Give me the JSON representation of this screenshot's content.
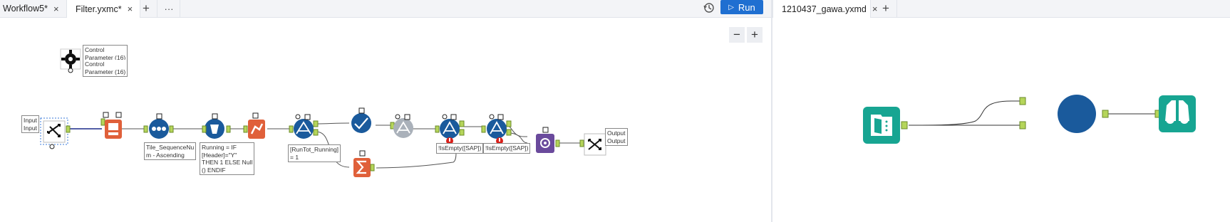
{
  "left_tabs": [
    {
      "label": "Workflow5*",
      "close": "×"
    },
    {
      "label": "Filter.yxmc*",
      "close": "×"
    }
  ],
  "left_toolbar": {
    "add": "+",
    "more": "···",
    "run_label": "Run",
    "run_icon": "play-icon",
    "history_icon": "history-icon"
  },
  "right_tabs": [
    {
      "label": "1210437_gawa.yxmd",
      "close": "×"
    }
  ],
  "right_toolbar": {
    "add": "+"
  },
  "zoom": {
    "out": "−",
    "in": "+"
  },
  "annotations": {
    "control_param_1": "Control\nParameter (16)",
    "control_param_2": "Control\nParameter (16)",
    "input": "Input\nInput",
    "sort": "Tile_SequenceNu\nm - Ascending",
    "formula": "Running = IF\n[Header]=\"Y\"\nTHEN 1 ELSE Null\n() ENDIF",
    "filter1": "[RunTot_Running]\n= 1",
    "filter3": "!IsEmpty([SAP])",
    "filter4": "!IsEmpty([SAP])",
    "output": "Output\nOutput"
  },
  "colors": {
    "blue_tool": "#1a5a9c",
    "orange_tool": "#e0603a",
    "purple_tool": "#6a4a9c",
    "teal_tool": "#17a592",
    "anchor_green": "#b5d55a",
    "run_blue": "#1f6fd1"
  }
}
